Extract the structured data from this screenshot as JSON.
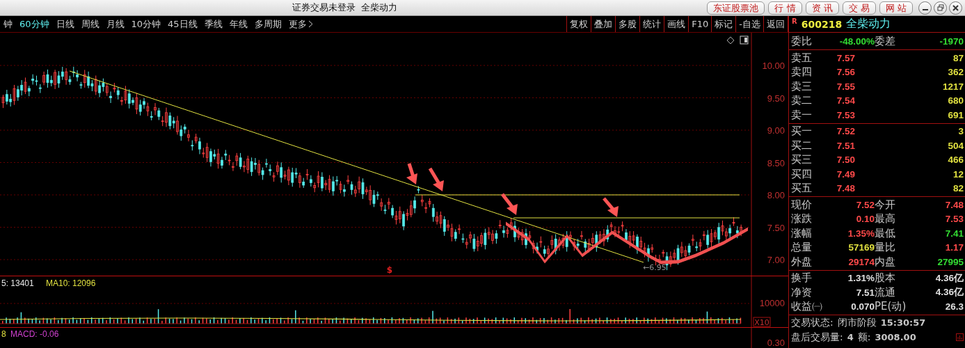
{
  "window": {
    "title": "证券交易未登录",
    "subtitle": "全柴动力"
  },
  "header_buttons": [
    "东证股票池",
    "行 情",
    "资 讯",
    "交 易",
    "网 站"
  ],
  "period_tabs": [
    {
      "label": "钟",
      "selected": false
    },
    {
      "label": "60分钟",
      "selected": true
    },
    {
      "label": "日线",
      "selected": false
    },
    {
      "label": "周线",
      "selected": false
    },
    {
      "label": "月线",
      "selected": false
    },
    {
      "label": "10分钟",
      "selected": false
    },
    {
      "label": "45日线",
      "selected": false
    },
    {
      "label": "季线",
      "selected": false
    },
    {
      "label": "年线",
      "selected": false
    },
    {
      "label": "多周期",
      "selected": false
    },
    {
      "label": "更多",
      "selected": false
    }
  ],
  "tools": [
    "复权",
    "叠加",
    "多股",
    "统计",
    "画线",
    "F10",
    "标记",
    "-自选",
    "返回"
  ],
  "quote_header": {
    "badge": "R",
    "code": "600218",
    "name": "全柴动力"
  },
  "price_chart": {
    "axis": [
      "10.00",
      "9.50",
      "9.00",
      "8.50",
      "8.00",
      "7.50",
      "7.00"
    ],
    "low_marker": "←6.95",
    "signal_mark": "$"
  },
  "volume_pane": {
    "legend": [
      {
        "text": "5: 13401",
        "color": "#e8e8e8"
      },
      {
        "text": "MA10: 12096",
        "color": "#e0e040"
      }
    ],
    "axis": "10000",
    "scale": "X10"
  },
  "macd_pane": {
    "legend": [
      {
        "text": "8",
        "color": "#e0e040"
      },
      {
        "text": "MACD: -0.06",
        "color": "#d040d0"
      }
    ],
    "axis": "0.30"
  },
  "order_ratio": {
    "label": "委比",
    "value": "-48.00%",
    "label2": "委差",
    "value2": "-1970"
  },
  "asks": [
    {
      "label": "卖五",
      "price": "7.57",
      "volume": "87"
    },
    {
      "label": "卖四",
      "price": "7.56",
      "volume": "362"
    },
    {
      "label": "卖三",
      "price": "7.55",
      "volume": "1217"
    },
    {
      "label": "卖二",
      "price": "7.54",
      "volume": "680"
    },
    {
      "label": "卖一",
      "price": "7.53",
      "volume": "691"
    }
  ],
  "bids": [
    {
      "label": "买一",
      "price": "7.52",
      "volume": "3"
    },
    {
      "label": "买二",
      "price": "7.51",
      "volume": "504"
    },
    {
      "label": "买三",
      "price": "7.50",
      "volume": "466"
    },
    {
      "label": "买四",
      "price": "7.49",
      "volume": "12"
    },
    {
      "label": "买五",
      "price": "7.48",
      "volume": "82"
    }
  ],
  "stats": [
    {
      "label": "现价",
      "value": "7.52",
      "color": "#ff4a4a"
    },
    {
      "label": "今开",
      "value": "7.48",
      "color": "#ff4a4a"
    },
    {
      "label": "涨跌",
      "value": "0.10",
      "color": "#ff4a4a"
    },
    {
      "label": "最高",
      "value": "7.53",
      "color": "#ff4a4a"
    },
    {
      "label": "涨幅",
      "value": "1.35%",
      "color": "#ff4a4a"
    },
    {
      "label": "最低",
      "value": "7.41",
      "color": "#33dd33"
    },
    {
      "label": "总量",
      "value": "57169",
      "color": "#e0e040"
    },
    {
      "label": "量比",
      "value": "1.17",
      "color": "#ff4a4a"
    },
    {
      "label": "外盘",
      "value": "29174",
      "color": "#ff4a4a"
    },
    {
      "label": "内盘",
      "value": "27995",
      "color": "#33dd33"
    }
  ],
  "fundamentals": [
    {
      "label": "换手",
      "value": "1.31%",
      "label2": "股本",
      "value2": "4.36亿"
    },
    {
      "label": "净资",
      "value": "7.51",
      "label2": "流通",
      "value2": "4.36亿"
    },
    {
      "label": "收益㈠",
      "value": "0.070",
      "label2": "PE(动)",
      "value2": "26.3"
    }
  ],
  "trading_status": {
    "label": "交易状态:",
    "value": "闭市阶段",
    "time": "15:30:57"
  },
  "after_hours": {
    "label": "盘后交易量:",
    "volume": "4",
    "amount_label": "额:",
    "amount": "3008.00"
  }
}
